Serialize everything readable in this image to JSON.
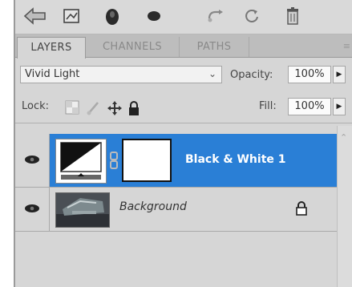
{
  "panel": {
    "tabs": [
      {
        "label": "LAYERS",
        "active": true
      },
      {
        "label": "CHANNELS",
        "active": false
      },
      {
        "label": "PATHS",
        "active": false
      }
    ],
    "blend_mode": "Vivid Light",
    "opacity_label": "Opacity:",
    "opacity_value": "100%",
    "lock_label": "Lock:",
    "fill_label": "Fill:",
    "fill_value": "100%"
  },
  "layers": [
    {
      "name": "Black & White 1",
      "selected": true,
      "visible": true,
      "type": "adjustment"
    },
    {
      "name": "Background",
      "selected": false,
      "visible": true,
      "type": "background",
      "locked": true
    }
  ],
  "colors": {
    "selection": "#2a7fd6",
    "panel_bg": "#d6d6d6"
  },
  "icons": [
    "layer-style-icon",
    "adjustment-icon",
    "mask-icon",
    "fill-circle-icon",
    "link-icon",
    "refresh-icon",
    "trash-icon",
    "eye-icon",
    "lock-icon"
  ]
}
